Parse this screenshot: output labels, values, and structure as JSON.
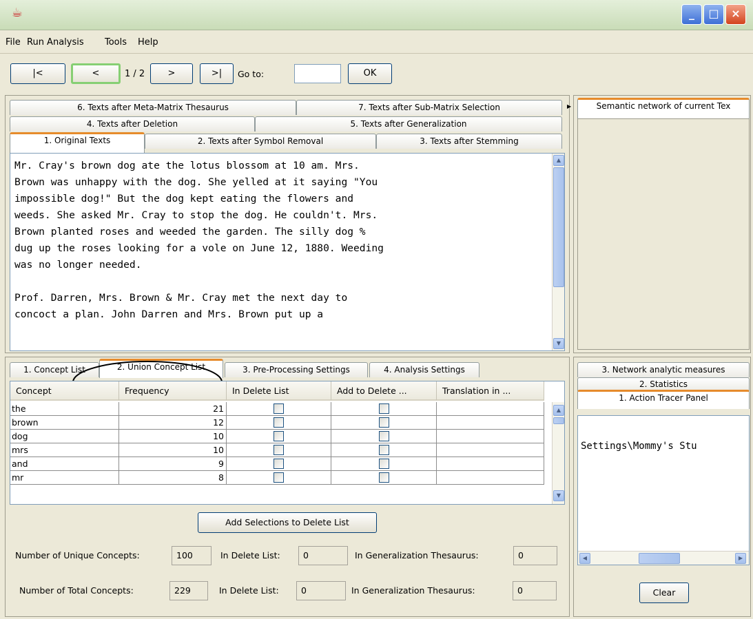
{
  "window": {
    "icon": "java-cup-icon",
    "minimize": "_",
    "maximize": "□",
    "close": "×"
  },
  "menu": [
    "File",
    "Run Analysis",
    "Tools",
    "Help"
  ],
  "nav": {
    "first": "|<",
    "prev": "<",
    "page": "1 / 2",
    "next": ">",
    "last": ">|",
    "goto_label": "Go to:",
    "goto_value": "",
    "ok": "OK"
  },
  "text_tabs": {
    "row1": [
      "6. Texts after Meta-Matrix Thesaurus",
      "7. Texts after Sub-Matrix Selection"
    ],
    "row2": [
      "4. Texts after Deletion",
      "5. Texts after Generalization"
    ],
    "row3": [
      "1. Original Texts",
      "2. Texts after Symbol Removal",
      "3. Texts after Stemming"
    ]
  },
  "text_content": "Mr. Cray's brown dog ate the lotus blossom at 10 am. Mrs.\nBrown was unhappy with the dog. She yelled at it saying \"You\nimpossible dog!\" But the dog kept eating the flowers and\nweeds. She asked Mr. Cray to stop the dog. He couldn't. Mrs.\nBrown planted roses and weeded the garden. The silly dog %\ndug up the roses looking for a vole on June 12, 1880. Weeding\nwas no longer needed.\n\nProf. Darren, Mrs. Brown & Mr. Cray met the next day to\nconcoct a plan. John Darren and Mrs. Brown put up a",
  "concept_tabs": [
    "1. Concept List",
    "2. Union Concept List",
    "3. Pre-Processing Settings",
    "4. Analysis Settings"
  ],
  "table": {
    "headers": [
      "Concept",
      "Frequency",
      "In Delete List",
      "Add to Delete ...",
      "Translation in ..."
    ],
    "rows": [
      {
        "concept": "the",
        "frequency": "21"
      },
      {
        "concept": "brown",
        "frequency": "12"
      },
      {
        "concept": "dog",
        "frequency": "10"
      },
      {
        "concept": "mrs",
        "frequency": "10"
      },
      {
        "concept": "and",
        "frequency": "9"
      },
      {
        "concept": "mr",
        "frequency": "8"
      }
    ]
  },
  "add_button": "Add Selections to Delete List",
  "stats": {
    "unique_label": "Number of Unique Concepts:",
    "unique_value": "100",
    "total_label": "Number of Total Concepts:",
    "total_value": "229",
    "delete_label": "In Delete List:",
    "delete_unique": "0",
    "delete_total": "0",
    "gen_label": "In Generalization Thesaurus:",
    "gen_unique": "0",
    "gen_total": "0"
  },
  "right_top_tab": "Semantic network of current Tex",
  "right_tabs": {
    "row1": "3. Network analytic measures",
    "row2": "2. Statistics",
    "row3": "1. Action Tracer Panel"
  },
  "tracer_text": "Settings\\Mommy's Stu",
  "clear_button": "Clear"
}
